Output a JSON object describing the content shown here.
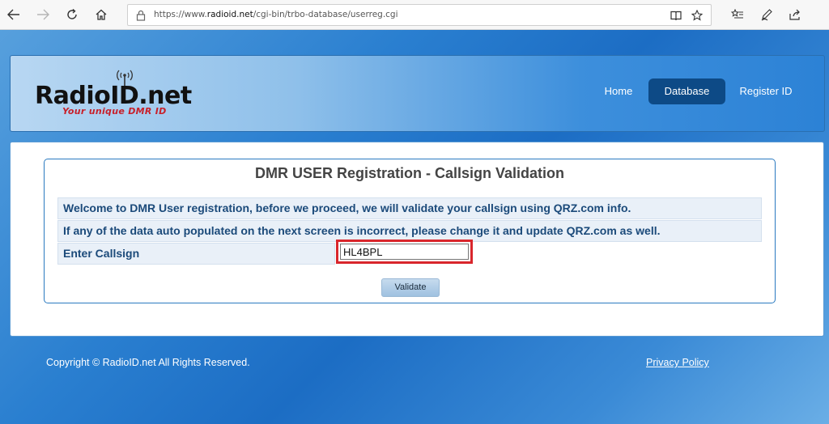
{
  "browser": {
    "url_prefix": "https://www.",
    "url_host": "radioid.net",
    "url_path": "/cgi-bin/trbo-database/userreg.cgi",
    "icons": {
      "back": "back-arrow-icon",
      "forward": "forward-arrow-icon",
      "refresh": "refresh-icon",
      "home": "home-icon",
      "lock": "lock-icon",
      "reading_view": "reading-view-icon",
      "favorite": "star-icon",
      "favorites_hub": "favorites-list-icon",
      "notes": "pen-icon",
      "share": "share-icon"
    }
  },
  "header": {
    "logo_main": "RadioID.net",
    "logo_tagline": "Your unique DMR ID",
    "nav": [
      {
        "label": "Home",
        "active": false
      },
      {
        "label": "Database",
        "active": true
      },
      {
        "label": "Register ID",
        "active": false
      }
    ]
  },
  "form": {
    "title": "DMR USER Registration - Callsign Validation",
    "welcome_text": "Welcome to DMR User registration, before we proceed, we will validate your callsign using QRZ.com info.",
    "notice_text": "If any of the data auto populated on the next screen is incorrect, please change it and update QRZ.com as well.",
    "callsign_label": "Enter Callsign",
    "callsign_value": "HL4BPL",
    "validate_label": "Validate"
  },
  "footer": {
    "copyright": "Copyright © RadioID.net All Rights Reserved.",
    "privacy_link": "Privacy Policy"
  },
  "colors": {
    "highlight_border": "#d9262c",
    "active_nav_bg": "#0d4a86",
    "row_text": "#1b4a7a"
  }
}
